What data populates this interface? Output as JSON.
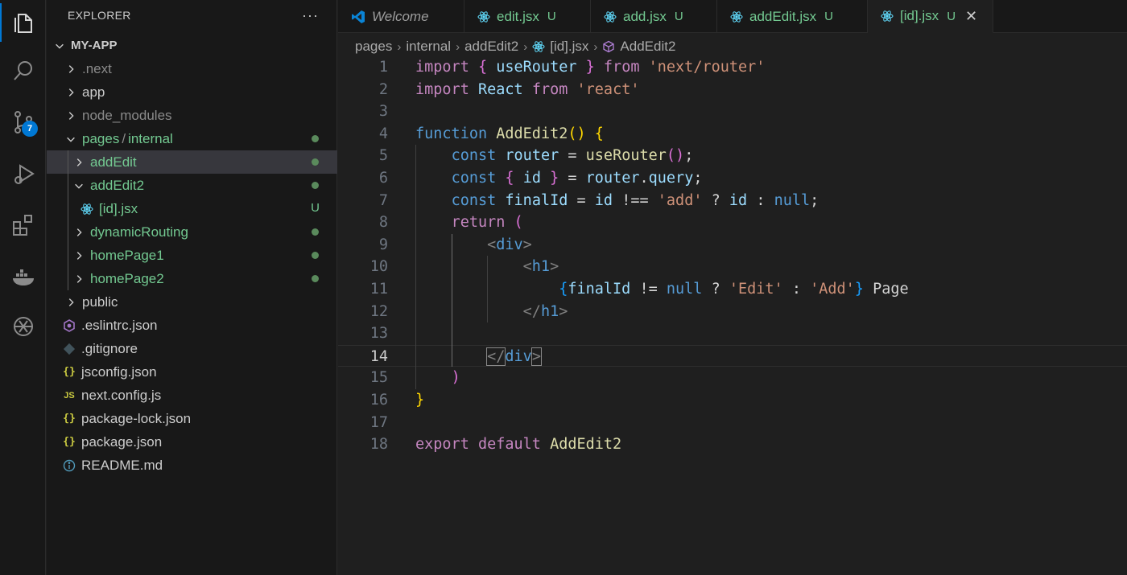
{
  "explorer": {
    "title": "EXPLORER",
    "more": "···",
    "project": "MY-APP",
    "items": [
      {
        "label": ".next",
        "kind": "folder",
        "state": "collapsed",
        "status": "",
        "color": "muted"
      },
      {
        "label": "app",
        "kind": "folder",
        "state": "collapsed",
        "status": "",
        "color": "normal"
      },
      {
        "label": "node_modules",
        "kind": "folder",
        "state": "collapsed",
        "status": "",
        "color": "muted"
      },
      {
        "label": "pages",
        "label2": "internal",
        "kind": "folder",
        "state": "expanded",
        "status": "dot",
        "color": "green"
      },
      {
        "label": "addEdit",
        "kind": "folder",
        "state": "collapsed",
        "status": "dot",
        "color": "green"
      },
      {
        "label": "addEdit2",
        "kind": "folder",
        "state": "expanded",
        "status": "dot",
        "color": "green"
      },
      {
        "label": "[id].jsx",
        "kind": "react-file",
        "status": "U",
        "color": "green"
      },
      {
        "label": "dynamicRouting",
        "kind": "folder",
        "state": "collapsed",
        "status": "dot",
        "color": "green"
      },
      {
        "label": "homePage1",
        "kind": "folder",
        "state": "collapsed",
        "status": "dot",
        "color": "green"
      },
      {
        "label": "homePage2",
        "kind": "folder",
        "state": "collapsed",
        "status": "dot",
        "color": "green"
      },
      {
        "label": "public",
        "kind": "folder",
        "state": "collapsed",
        "status": "",
        "color": "normal"
      },
      {
        "label": ".eslintrc.json",
        "kind": "eslint-file",
        "status": "",
        "color": "normal"
      },
      {
        "label": ".gitignore",
        "kind": "git-file",
        "status": "",
        "color": "normal"
      },
      {
        "label": "jsconfig.json",
        "kind": "json-file",
        "status": "",
        "color": "normal"
      },
      {
        "label": "next.config.js",
        "kind": "js-file",
        "status": "",
        "color": "normal"
      },
      {
        "label": "package-lock.json",
        "kind": "json-file",
        "status": "",
        "color": "normal"
      },
      {
        "label": "package.json",
        "kind": "json-file",
        "status": "",
        "color": "normal"
      },
      {
        "label": "README.md",
        "kind": "info-file",
        "status": "",
        "color": "normal"
      }
    ]
  },
  "activity": {
    "source_control_badge": "7"
  },
  "tabs": [
    {
      "label": "Welcome",
      "icon": "vscode-icon",
      "status": "",
      "active": false
    },
    {
      "label": "edit.jsx",
      "icon": "react-icon",
      "status": "U",
      "active": false
    },
    {
      "label": "add.jsx",
      "icon": "react-icon",
      "status": "U",
      "active": false
    },
    {
      "label": "addEdit.jsx",
      "icon": "react-icon",
      "status": "U",
      "active": false
    },
    {
      "label": "[id].jsx",
      "icon": "react-icon",
      "status": "U",
      "active": true,
      "close": "✕"
    }
  ],
  "breadcrumb": [
    "pages",
    "internal",
    "addEdit2",
    "[id].jsx",
    "AddEdit2"
  ],
  "editor": {
    "current_line": 14,
    "lines": [
      "import { useRouter } from 'next/router'",
      "import React from 'react'",
      "",
      "function AddEdit2() {",
      "    const router = useRouter();",
      "    const { id } = router.query;",
      "    const finalId = id !== 'add' ? id : null;",
      "    return (",
      "        <div>",
      "            <h1>",
      "                {finalId != null ? 'Edit' : 'Add'} Page",
      "            </h1>",
      "",
      "        </div>",
      "    )",
      "}",
      "",
      "export default AddEdit2"
    ]
  },
  "colors": {
    "accent": "#0078d4",
    "git_untracked": "#73c991",
    "background": "#1f1f1f"
  }
}
